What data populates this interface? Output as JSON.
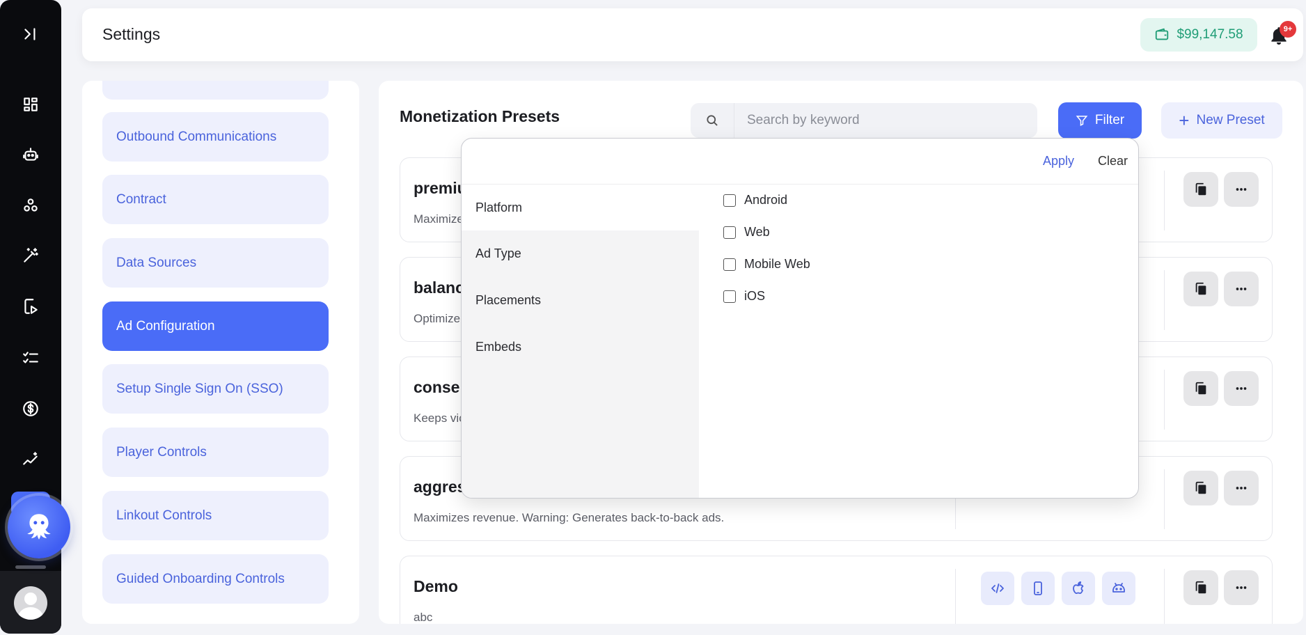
{
  "header": {
    "title": "Settings",
    "balance": "$99,147.58",
    "notifications_badge": "9+"
  },
  "rail": {
    "icons": [
      "collapse-icon",
      "dashboard-icon",
      "robot-icon",
      "workflow-icon",
      "magic-wand-icon",
      "video-icon",
      "checklist-icon",
      "dollar-icon",
      "analytics-icon"
    ],
    "assistant": "octopus-icon"
  },
  "settings_nav": {
    "items": [
      {
        "label": "Outbound Communications"
      },
      {
        "label": "Contract"
      },
      {
        "label": "Data Sources"
      },
      {
        "label": "Ad Configuration",
        "active": true
      },
      {
        "label": "Setup Single Sign On (SSO)"
      },
      {
        "label": "Player Controls"
      },
      {
        "label": "Linkout Controls"
      },
      {
        "label": "Guided Onboarding Controls"
      }
    ]
  },
  "main": {
    "title": "Monetization Presets",
    "search_placeholder": "Search by keyword",
    "filter_label": "Filter",
    "new_preset_label": "New Preset"
  },
  "presets": [
    {
      "name": "premiu",
      "description": "Maximize"
    },
    {
      "name": "balanc",
      "description": "Optimize"
    },
    {
      "name": "conser",
      "description": "Keeps vic"
    },
    {
      "name": "aggres",
      "description": "Maximizes revenue. Warning: Generates back-to-back ads."
    },
    {
      "name": "Demo",
      "description": "abc",
      "platforms": [
        "embed-code-icon",
        "mobile-icon",
        "apple-icon",
        "android-icon"
      ]
    }
  ],
  "filter_dropdown": {
    "apply_label": "Apply",
    "clear_label": "Clear",
    "categories": [
      {
        "label": "Platform",
        "active": true
      },
      {
        "label": "Ad Type"
      },
      {
        "label": "Placements"
      },
      {
        "label": "Embeds"
      }
    ],
    "options": [
      "Android",
      "Web",
      "Mobile Web",
      "iOS"
    ]
  },
  "colors": {
    "accent": "#4a6cf7",
    "accent_light": "#eef0fd",
    "balance_green": "#1f9d76",
    "badge_red": "#e4383b",
    "rail": "#0a0b0e"
  }
}
